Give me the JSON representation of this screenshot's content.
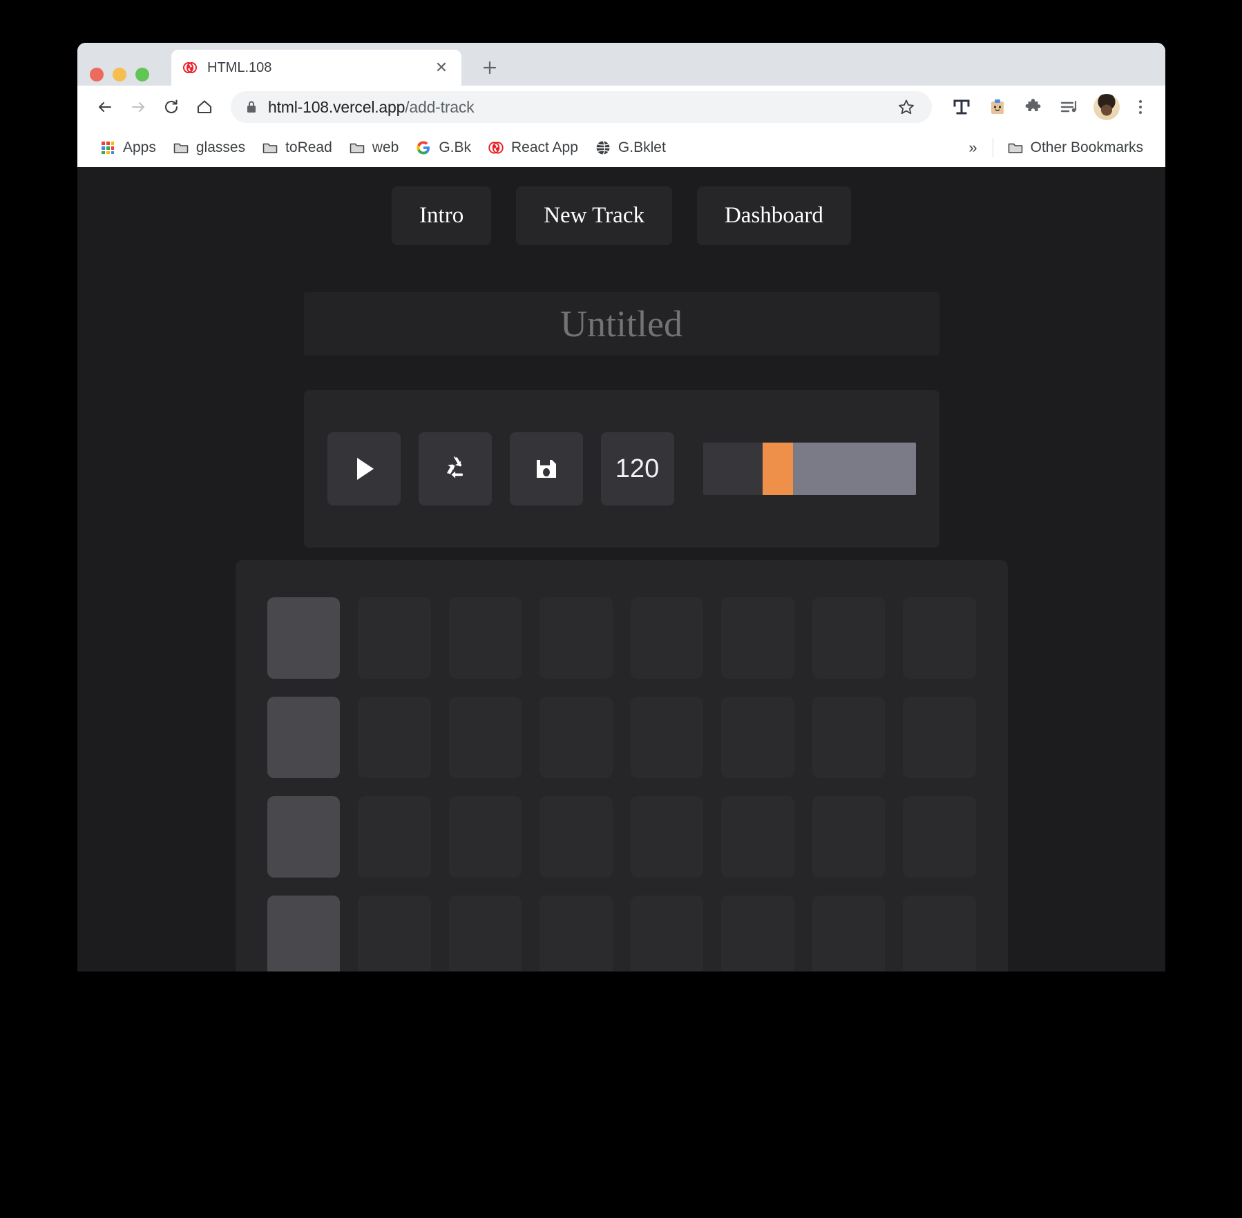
{
  "browser": {
    "tab": {
      "title": "HTML.108",
      "favicon_icon": "react-app-favicon",
      "close_icon": "close-icon"
    },
    "new_tab_label": "+",
    "omnibox": {
      "lock_icon": "lock-icon",
      "url_domain": "html-108.vercel.app",
      "url_path": "/add-track",
      "star_icon": "star-icon"
    },
    "nav": {
      "back_icon": "back-arrow-icon",
      "forward_icon": "forward-arrow-icon",
      "reload_icon": "reload-icon",
      "home_icon": "home-icon"
    },
    "toolbar_icons": [
      {
        "name": "grammarly-icon"
      },
      {
        "name": "clipboard-icon"
      },
      {
        "name": "extensions-puzzle-icon"
      },
      {
        "name": "playlist-icon"
      },
      {
        "name": "profile-avatar"
      },
      {
        "name": "chrome-menu-kebab-icon"
      }
    ],
    "bookmarks": [
      {
        "label": "Apps",
        "icon": "apps-grid-icon"
      },
      {
        "label": "glasses",
        "icon": "folder-icon"
      },
      {
        "label": "toRead",
        "icon": "folder-icon"
      },
      {
        "label": "web",
        "icon": "folder-icon"
      },
      {
        "label": "G.Bk",
        "icon": "google-icon"
      },
      {
        "label": "React App",
        "icon": "react-app-favicon"
      },
      {
        "label": "G.Bklet",
        "icon": "globe-icon"
      }
    ],
    "bookmarks_overflow": "»",
    "other_bookmarks": {
      "label": "Other Bookmarks",
      "icon": "folder-icon"
    }
  },
  "app": {
    "nav": [
      {
        "label": "Intro"
      },
      {
        "label": "New Track"
      },
      {
        "label": "Dashboard"
      }
    ],
    "track_title": {
      "value": "",
      "placeholder": "Untitled"
    },
    "transport": {
      "play_icon": "play-icon",
      "loop_icon": "recycle-loop-icon",
      "save_icon": "floppy-save-icon",
      "bpm_value": "120",
      "volume_slider": {
        "fill_percent": 30,
        "thumb_percent": 17,
        "thumb_color": "#ee8f4a",
        "track_color": "#7b7b87",
        "fill_color": "#37373b"
      }
    },
    "sequencer": {
      "rows": 4,
      "columns": 8,
      "active_column": 1,
      "pad_color": "#2b2b2e",
      "pad_active_color": "#48484d",
      "grid": [
        [
          1,
          0,
          0,
          0,
          0,
          0,
          0,
          0
        ],
        [
          1,
          0,
          0,
          0,
          0,
          0,
          0,
          0
        ],
        [
          1,
          0,
          0,
          0,
          0,
          0,
          0,
          0
        ],
        [
          1,
          0,
          0,
          0,
          0,
          0,
          0,
          0
        ]
      ]
    }
  },
  "colors": {
    "page_bg": "#1c1c1e",
    "panel_bg": "#262629",
    "accent": "#ee8f4a"
  }
}
